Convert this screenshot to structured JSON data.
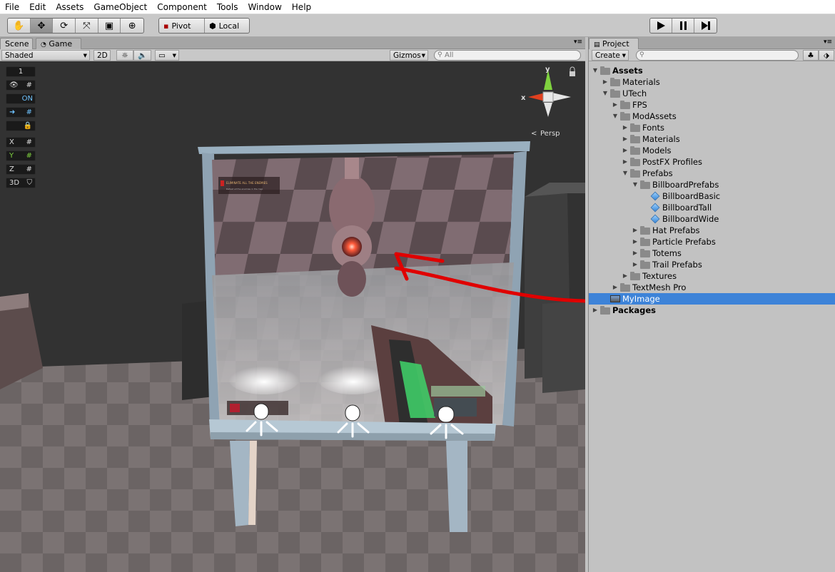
{
  "menu": [
    "File",
    "Edit",
    "Assets",
    "GameObject",
    "Component",
    "Tools",
    "Window",
    "Help"
  ],
  "toolbar": {
    "pivot_label": "Pivot",
    "local_label": "Local"
  },
  "scene_tabs": {
    "scene": "Scene",
    "game": "Game"
  },
  "scene_toolbar": {
    "shading": "Shaded",
    "mode_2d": "2D",
    "gizmos": "Gizmos",
    "search_placeholder": "All"
  },
  "gizmo_buttons": {
    "one": "1",
    "on": "ON",
    "x": "X",
    "y": "Y",
    "z": "Z",
    "three_d": "3D"
  },
  "orientation": {
    "y": "y",
    "x": "x",
    "persp": "Persp"
  },
  "screen_hud": {
    "objective": "ELIMINATE ALL THE ENEMIES",
    "objective_sub": "Defeat all the enemies in the map"
  },
  "project": {
    "tab": "Project",
    "create": "Create",
    "tree": [
      {
        "label": "Assets",
        "bold": true
      },
      {
        "label": "Materials"
      },
      {
        "label": "UTech"
      },
      {
        "label": "FPS"
      },
      {
        "label": "ModAssets"
      },
      {
        "label": "Fonts"
      },
      {
        "label": "Materials"
      },
      {
        "label": "Models"
      },
      {
        "label": "PostFX Profiles"
      },
      {
        "label": "Prefabs"
      },
      {
        "label": "BillboardPrefabs"
      },
      {
        "label": "BillboardBasic"
      },
      {
        "label": "BillboardTall"
      },
      {
        "label": "BillboardWide"
      },
      {
        "label": "Hat Prefabs"
      },
      {
        "label": "Particle Prefabs"
      },
      {
        "label": "Totems"
      },
      {
        "label": "Trail Prefabs"
      },
      {
        "label": "Textures"
      },
      {
        "label": "TextMesh Pro"
      },
      {
        "label": "MyImage"
      },
      {
        "label": "Packages",
        "bold": true
      }
    ]
  },
  "colors": {
    "selection": "#3d83d8",
    "annotation": "#e00000",
    "sky": "#323232"
  }
}
